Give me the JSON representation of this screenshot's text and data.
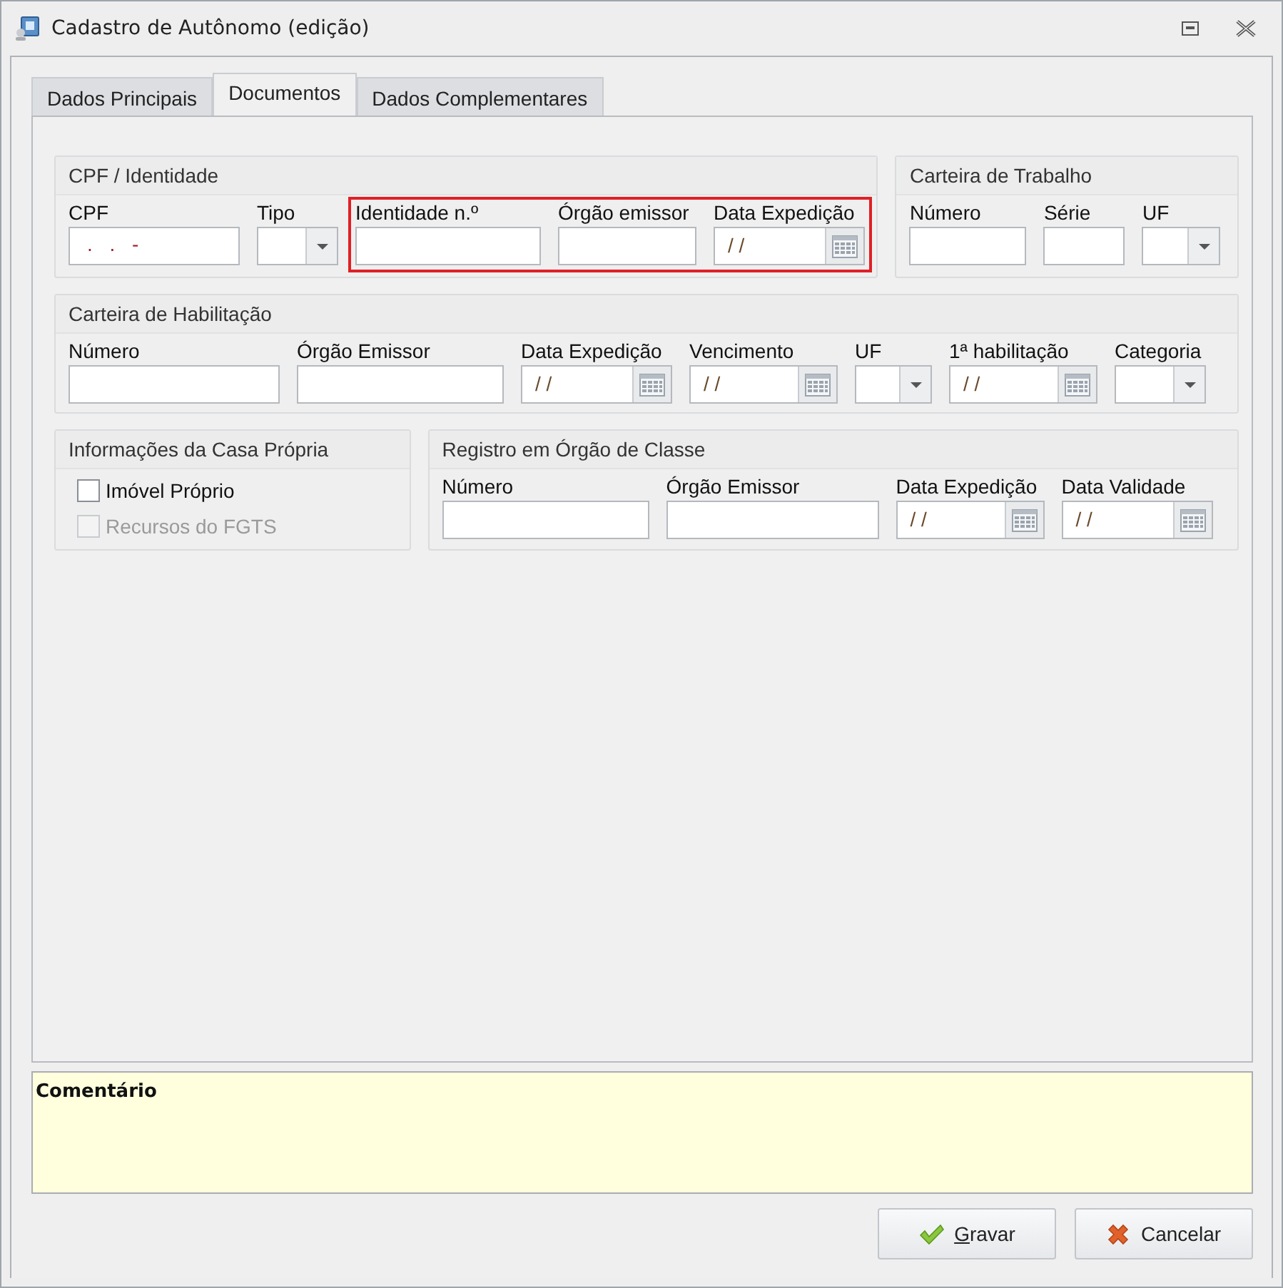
{
  "window": {
    "title": "Cadastro de Autônomo (edição)"
  },
  "tabs": [
    {
      "label": "Dados Principais",
      "selected": false
    },
    {
      "label": "Documentos",
      "selected": true
    },
    {
      "label": "Dados Complementares",
      "selected": false
    }
  ],
  "rows": [
    [
      {
        "title": "CPF / Identidade",
        "fields": [
          {
            "kind": "masked",
            "label": "CPF",
            "value": ". . -",
            "highlighted": false
          },
          {
            "kind": "select",
            "label": "Tipo",
            "highlighted": false
          },
          {
            "kind": "text",
            "label": "Identidade n.º",
            "highlighted": true
          },
          {
            "kind": "text",
            "label": "Órgão emissor",
            "highlighted": true
          },
          {
            "kind": "date",
            "label": "Data Expedição",
            "value": "/ /",
            "highlighted": true
          }
        ]
      },
      {
        "title": "Carteira de Trabalho",
        "fields": [
          {
            "kind": "text",
            "label": "Número",
            "highlighted": false
          },
          {
            "kind": "text",
            "label": "Série",
            "highlighted": false
          },
          {
            "kind": "select",
            "label": "UF",
            "highlighted": false
          }
        ]
      }
    ],
    [
      {
        "title": "Carteira de Habilitação",
        "fields": [
          {
            "kind": "text",
            "label": "Número",
            "highlighted": false
          },
          {
            "kind": "text",
            "label": "Órgão Emissor",
            "highlighted": false
          },
          {
            "kind": "date",
            "label": "Data Expedição",
            "value": "/ /",
            "highlighted": false
          },
          {
            "kind": "date",
            "label": "Vencimento",
            "value": "/ /",
            "highlighted": false
          },
          {
            "kind": "select",
            "label": "UF",
            "highlighted": false
          },
          {
            "kind": "date",
            "label": "1ª habilitação",
            "value": "/ /",
            "highlighted": false
          },
          {
            "kind": "select",
            "label": "Categoria",
            "highlighted": false
          }
        ]
      }
    ],
    [
      {
        "title": "Informações da Casa Própria",
        "checkboxes": [
          {
            "label": "Imóvel Próprio",
            "checked": false,
            "disabled": false
          },
          {
            "label": "Recursos do FGTS",
            "checked": false,
            "disabled": true
          }
        ]
      },
      {
        "title": "Registro em Órgão de Classe",
        "fields": [
          {
            "kind": "text",
            "label": "Número",
            "highlighted": false
          },
          {
            "kind": "text",
            "label": "Órgão Emissor",
            "highlighted": false
          },
          {
            "kind": "date",
            "label": "Data Expedição",
            "value": "/ /",
            "highlighted": false
          },
          {
            "kind": "date",
            "label": "Data Validade",
            "value": "/ /",
            "highlighted": false
          }
        ]
      }
    ]
  ],
  "comment": {
    "label": "Comentário"
  },
  "buttons": [
    {
      "kind": "confirm",
      "label": "Gravar"
    },
    {
      "kind": "cancel",
      "label": "Cancelar"
    }
  ]
}
